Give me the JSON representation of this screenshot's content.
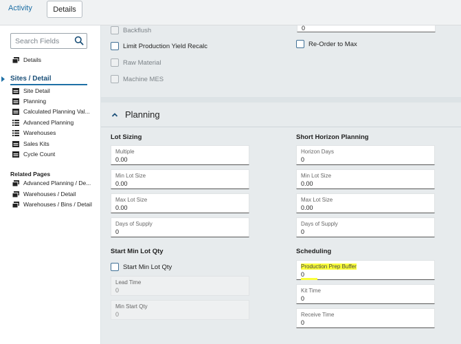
{
  "tabs": {
    "activity": "Activity",
    "details": "Details"
  },
  "sidebar": {
    "search_placeholder": "Search Fields",
    "details_item": "Details",
    "section_title": "Sites / Detail",
    "items": [
      {
        "label": "Site Detail",
        "icon": "form-icon"
      },
      {
        "label": "Planning",
        "icon": "form-icon"
      },
      {
        "label": "Calculated Planning Val...",
        "icon": "form-icon"
      },
      {
        "label": "Advanced Planning",
        "icon": "list-icon"
      },
      {
        "label": "Warehouses",
        "icon": "list-icon"
      },
      {
        "label": "Sales Kits",
        "icon": "form-icon"
      },
      {
        "label": "Cycle Count",
        "icon": "form-icon"
      }
    ],
    "related_title": "Related Pages",
    "related": [
      {
        "label": "Advanced Planning / De...",
        "icon": "pages-icon"
      },
      {
        "label": "Warehouses / Detail",
        "icon": "pages-icon"
      },
      {
        "label": "Warehouses / Bins / Detail",
        "icon": "pages-icon"
      }
    ]
  },
  "top_panel": {
    "checkboxes": [
      {
        "label": "Backflush",
        "enabled": false,
        "checked": false
      },
      {
        "label": "Limit Production Yield Recalc",
        "enabled": true,
        "checked": false
      },
      {
        "label": "Raw Material",
        "enabled": false,
        "checked": false
      },
      {
        "label": "Machine MES",
        "enabled": false,
        "checked": false
      },
      {
        "label": "Re-Order to Max",
        "enabled": true,
        "checked": false
      }
    ],
    "partial_field_value": "0"
  },
  "planning": {
    "title": "Planning",
    "lot_sizing": {
      "title": "Lot Sizing",
      "fields": [
        {
          "label": "Multiple",
          "value": "0.00"
        },
        {
          "label": "Min Lot Size",
          "value": "0.00"
        },
        {
          "label": "Max Lot Size",
          "value": "0.00"
        },
        {
          "label": "Days of Supply",
          "value": "0"
        }
      ]
    },
    "short_horizon": {
      "title": "Short Horizon Planning",
      "fields": [
        {
          "label": "Horizon Days",
          "value": "0"
        },
        {
          "label": "Min Lot Size",
          "value": "0.00"
        },
        {
          "label": "Max Lot Size",
          "value": "0.00"
        },
        {
          "label": "Days of Supply",
          "value": "0"
        }
      ]
    },
    "start_min_lot": {
      "title": "Start Min Lot Qty",
      "checkbox_label": "Start Min Lot Qty",
      "fields": [
        {
          "label": "Lead Time",
          "value": "0"
        },
        {
          "label": "Min Start Qty",
          "value": "0"
        }
      ]
    },
    "scheduling": {
      "title": "Scheduling",
      "fields": [
        {
          "label": "Production Prep Buffer",
          "value": "0"
        },
        {
          "label": "Kit Time",
          "value": "0"
        },
        {
          "label": "Receive Time",
          "value": "0"
        }
      ]
    }
  },
  "colors": {
    "accent": "#1d6fa5",
    "highlight": "#fbff3a",
    "panel_bg": "#e7ebed"
  }
}
